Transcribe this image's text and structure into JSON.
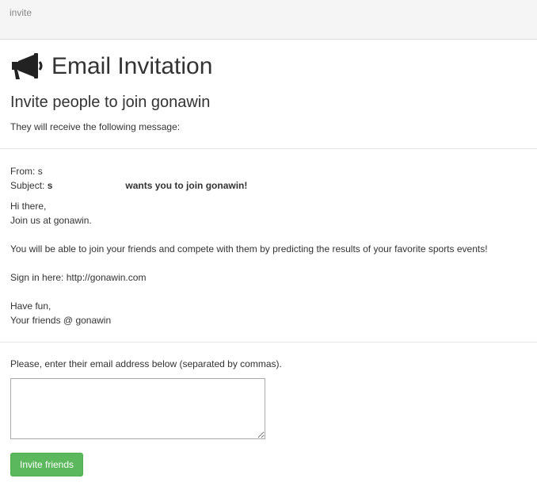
{
  "breadcrumb": {
    "current": "invite"
  },
  "page": {
    "title": "Email Invitation",
    "subtitle": "Invite people to join gonawin",
    "intro": "They will receive the following message:"
  },
  "message": {
    "from_label": "From:",
    "from_value": "s",
    "subject_label": "Subject:",
    "subject_name": "s",
    "subject_text": "wants you to join gonawin!",
    "greeting": "Hi there,",
    "join_line": "Join us at gonawin.",
    "body": "You will be able to join your friends and compete with them by predicting the results of your favorite sports events!",
    "signin": "Sign in here: http://gonawin.com",
    "closing": "Have fun,",
    "signature": "Your friends @ gonawin"
  },
  "form": {
    "label": "Please, enter their email address below (separated by commas).",
    "emails_value": "",
    "submit_label": "Invite friends"
  },
  "colors": {
    "accent_button": "#5cb85c",
    "text": "#333333"
  },
  "icons": {
    "title_icon": "megaphone-icon"
  }
}
